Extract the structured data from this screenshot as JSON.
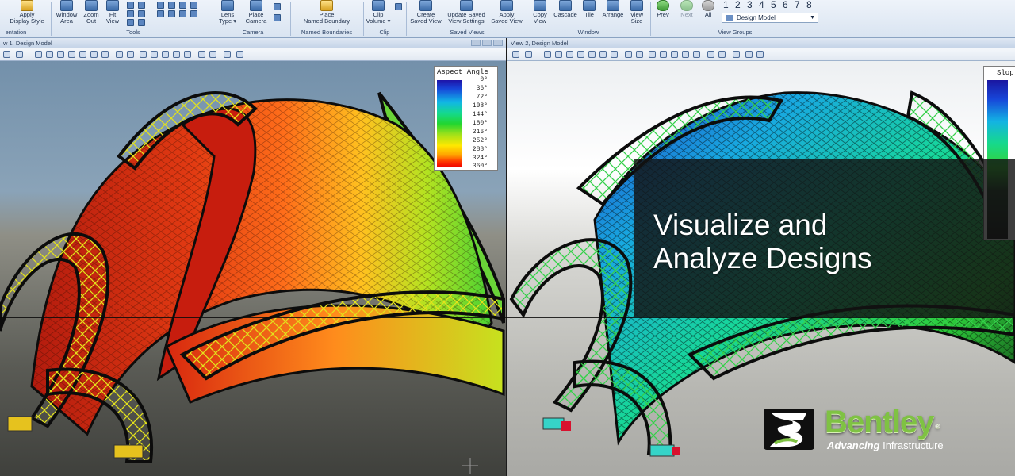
{
  "ribbon": {
    "groups": [
      {
        "label": "entation",
        "buttons": [
          {
            "label": "Apply Display Style",
            "lines": [
              "Apply",
              "Display Style"
            ]
          }
        ]
      },
      {
        "label": "Tools",
        "buttons": [
          {
            "label": "Window Area",
            "lines": [
              "Window",
              "Area"
            ]
          },
          {
            "label": "Zoom Out",
            "lines": [
              "Zoom",
              "Out"
            ]
          },
          {
            "label": "Fit View",
            "lines": [
              "Fit",
              "View"
            ]
          }
        ]
      },
      {
        "label": "Camera",
        "buttons": [
          {
            "label": "Lens Type",
            "lines": [
              "Lens",
              "Type ▾"
            ]
          },
          {
            "label": "Place Camera",
            "lines": [
              "Place",
              "Camera"
            ]
          }
        ]
      },
      {
        "label": "Named Boundaries",
        "buttons": [
          {
            "label": "Place Named Boundary",
            "lines": [
              "Place",
              "Named Boundary"
            ]
          }
        ]
      },
      {
        "label": "Clip",
        "buttons": [
          {
            "label": "Clip Volume",
            "lines": [
              "Clip",
              "Volume ▾"
            ]
          }
        ]
      },
      {
        "label": "Saved Views",
        "buttons": [
          {
            "label": "Create Saved View",
            "lines": [
              "Create",
              "Saved View"
            ]
          },
          {
            "label": "Update Saved View Settings",
            "lines": [
              "Update Saved",
              "View Settings"
            ]
          },
          {
            "label": "Apply Saved View",
            "lines": [
              "Apply",
              "Saved View"
            ]
          }
        ]
      },
      {
        "label": "Window",
        "buttons": [
          {
            "label": "Copy View",
            "lines": [
              "Copy",
              "View"
            ]
          },
          {
            "label": "Cascade",
            "lines": [
              "Cascade"
            ]
          },
          {
            "label": "Tile",
            "lines": [
              "Tile"
            ]
          },
          {
            "label": "Arrange",
            "lines": [
              "Arrange"
            ]
          },
          {
            "label": "View Size",
            "lines": [
              "View",
              "Size"
            ]
          }
        ]
      },
      {
        "label": "View Groups",
        "buttons": [
          {
            "label": "Prev",
            "lines": [
              "Prev"
            ]
          },
          {
            "label": "Next",
            "lines": [
              "Next"
            ]
          },
          {
            "label": "All",
            "lines": [
              "All"
            ]
          }
        ]
      }
    ],
    "view_numbers": [
      "1",
      "2",
      "3",
      "4",
      "5",
      "6",
      "7",
      "8"
    ],
    "view_group_combo": "Design Model"
  },
  "view1": {
    "title": "w 1, Design Model"
  },
  "view2": {
    "title": "View 2, Design Model"
  },
  "legend": {
    "title": "Aspect Angle",
    "ticks": [
      "0°",
      "36°",
      "72°",
      "108°",
      "144°",
      "180°",
      "216°",
      "252°",
      "288°",
      "324°",
      "360°"
    ]
  },
  "slope_legend": {
    "title": "Slop"
  },
  "headline": {
    "line1": "Visualize and",
    "line2": "Analyze Designs"
  },
  "logo": {
    "wordmark": "Bentley",
    "registered": "®",
    "tagline_bold": "Advancing",
    "tagline_rest": " Infrastructure"
  },
  "colors": {
    "brand_green": "#7fc243",
    "ribbon_bg": "#dfe8f3"
  }
}
